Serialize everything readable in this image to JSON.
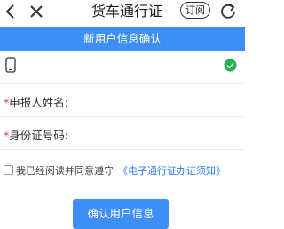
{
  "navbar": {
    "back_icon": "chevron-left-icon",
    "close_icon": "close-icon",
    "title": "货车通行证",
    "subscribe_label": "订阅",
    "refresh_icon": "refresh-icon"
  },
  "banner": {
    "text": "新用户信息确认"
  },
  "phone_row": {
    "icon": "mobile-phone-icon",
    "value": "",
    "status_icon": "check-circle-icon",
    "status_color": "#22b14c"
  },
  "form": {
    "required_mark": "*",
    "name_label": "申报人姓名:",
    "name_value": "",
    "id_label": "身份证号码:",
    "id_value": ""
  },
  "agreement": {
    "text": "我已经阅读并同意遵守",
    "link_text": "《电子通行证办证须知》",
    "checked": false
  },
  "confirm_button": {
    "label": "确认用户信息"
  },
  "colors": {
    "accent": "#3d8ef5",
    "link": "#2f7de8",
    "required": "#e23a3a"
  }
}
